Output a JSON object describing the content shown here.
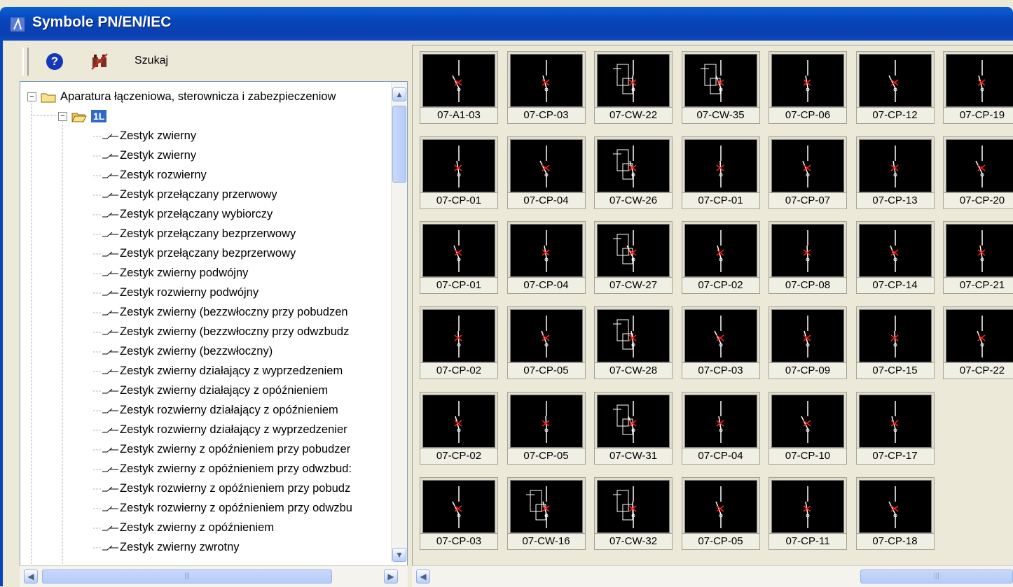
{
  "window": {
    "title": "Symbole PN/EN/IEC"
  },
  "toolbar": {
    "search_label": "Szukaj"
  },
  "tree": {
    "root": "Aparatura łączeniowa, sterownicza i zabezpieczeniow",
    "group": "1L",
    "items": [
      "Zestyk zwierny",
      "Zestyk zwierny",
      "Zestyk rozwierny",
      "Zestyk przełączany przerwowy",
      "Zestyk przełączany wybiorczy",
      "Zestyk przełączany bezprzerwowy",
      "Zestyk przełączany bezprzerwowy",
      "Zestyk zwierny podwójny",
      "Zestyk rozwierny podwójny",
      "Zestyk zwierny (bezzwłoczny przy pobudzen",
      "Zestyk zwierny (bezzwłoczny przy odwzbudz",
      "Zestyk zwierny (bezzwłoczny)",
      "Zestyk zwierny działający z wyprzedzeniem",
      "Zestyk zwierny działający z opóźnieniem",
      "Zestyk rozwierny działający z opóźnieniem",
      "Zestyk rozwierny działający z wyprzedzenier",
      "Zestyk zwierny z opóźnieniem przy pobudzer",
      "Zestyk zwierny z opóźnieniem przy odwzbud:",
      "Zestyk rozwierny z opóźnieniem przy pobudz",
      "Zestyk rozwierny z opóźnieniem przy odwzbu",
      "Zestyk zwierny z opóźnieniem",
      "Zestyk zwierny zwrotny"
    ]
  },
  "gallery": {
    "columns": [
      [
        "07-A1-03",
        "07-CP-01",
        "07-CP-01",
        "07-CP-02",
        "07-CP-02",
        "07-CP-03"
      ],
      [
        "07-CP-03",
        "07-CP-04",
        "07-CP-04",
        "07-CP-05",
        "07-CP-05",
        "07-CW-16"
      ],
      [
        "07-CW-22",
        "07-CW-26",
        "07-CW-27",
        "07-CW-28",
        "07-CW-31",
        "07-CW-32"
      ],
      [
        "07-CW-35",
        "07-CP-01",
        "07-CP-02",
        "07-CP-03",
        "07-CP-04",
        "07-CP-05"
      ],
      [
        "07-CP-06",
        "07-CP-07",
        "07-CP-08",
        "07-CP-09",
        "07-CP-10",
        "07-CP-11"
      ],
      [
        "07-CP-12",
        "07-CP-13",
        "07-CP-14",
        "07-CP-15",
        "07-CP-17",
        "07-CP-18"
      ],
      [
        "07-CP-19",
        "07-CP-20",
        "07-CP-21",
        "07-CP-22"
      ]
    ]
  },
  "colors": {
    "titlebar": "#0845b8",
    "selection": "#316ac5",
    "symbol_accent": "#ff2020"
  },
  "icons": {
    "window": "app-icon",
    "help": "help-icon",
    "search": "binoculars-icon"
  }
}
